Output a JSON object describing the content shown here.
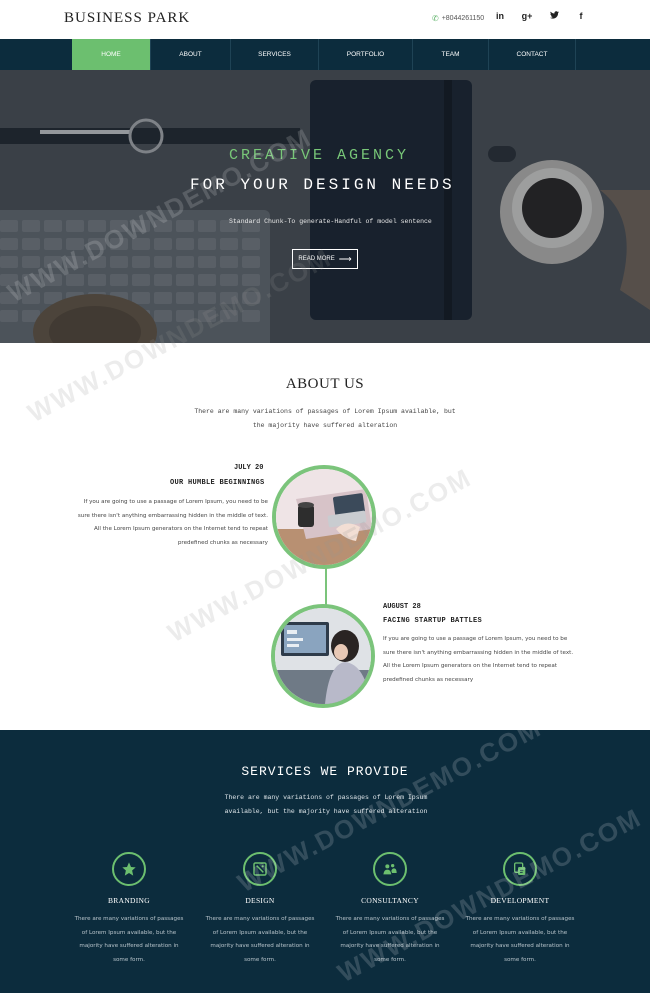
{
  "header": {
    "brand": "BUSINESS PARK",
    "phone": "+8044261150",
    "socials": [
      "in",
      "g+",
      "twitter",
      "f"
    ]
  },
  "nav": {
    "items": [
      {
        "label": "HOME",
        "active": true
      },
      {
        "label": "ABOUT",
        "active": false
      },
      {
        "label": "SERVICES",
        "active": false
      },
      {
        "label": "PORTFOLIO",
        "active": false
      },
      {
        "label": "TEAM",
        "active": false
      },
      {
        "label": "CONTACT",
        "active": false
      }
    ]
  },
  "hero": {
    "kicker": "CREATIVE AGENCY",
    "title": "FOR YOUR DESIGN NEEDS",
    "description": "Standard Chunk-To generate-Handful of model sentence",
    "button_label": "READ MORE"
  },
  "about": {
    "title": "ABOUT US",
    "description": "There are many variations of passages of Lorem Ipsum available, but the majority have suffered alteration",
    "events": [
      {
        "date": "JULY 20",
        "heading": "OUR HUMBLE BEGINNINGS",
        "body": "If you are going to use a passage of Lorem Ipsum, you need to be sure there isn't anything embarrassing hidden in the middle of text. All the Lorem Ipsum generators on the Internet tend to repeat predefined chunks as necessary"
      },
      {
        "date": "AUGUST 28",
        "heading": "FACING STARTUP BATTLES",
        "body": "If you are going to use a passage of Lorem Ipsum, you need to be sure there isn't anything embarrassing hidden in the middle of text. All the Lorem Ipsum generators on the Internet tend to repeat predefined chunks as necessary"
      }
    ]
  },
  "services": {
    "title": "SERVICES WE PROVIDE",
    "description": "There are many variations of passages of Lorem Ipsum available, but the majority have suffered alteration",
    "items": [
      {
        "name": "BRANDING",
        "icon": "star-icon",
        "text": "There are many variations of passages of Lorem Ipsum available, but the majority have suffered alteration in some form."
      },
      {
        "name": "DESIGN",
        "icon": "design-icon",
        "text": "There are many variations of passages of Lorem Ipsum available, but the majority have suffered alteration in some form."
      },
      {
        "name": "CONSULTANCY",
        "icon": "consultancy-icon",
        "text": "There are many variations of passages of Lorem Ipsum available, but the majority have suffered alteration in some form."
      },
      {
        "name": "DEVELOPMENT",
        "icon": "development-icon",
        "text": "There are many variations of passages of Lorem Ipsum available, but the majority have suffered alteration in some form."
      }
    ]
  },
  "watermark": "WWW.DOWNDEMO.COM",
  "colors": {
    "accent": "#6cbf6f",
    "navy": "#0c2c3d"
  }
}
